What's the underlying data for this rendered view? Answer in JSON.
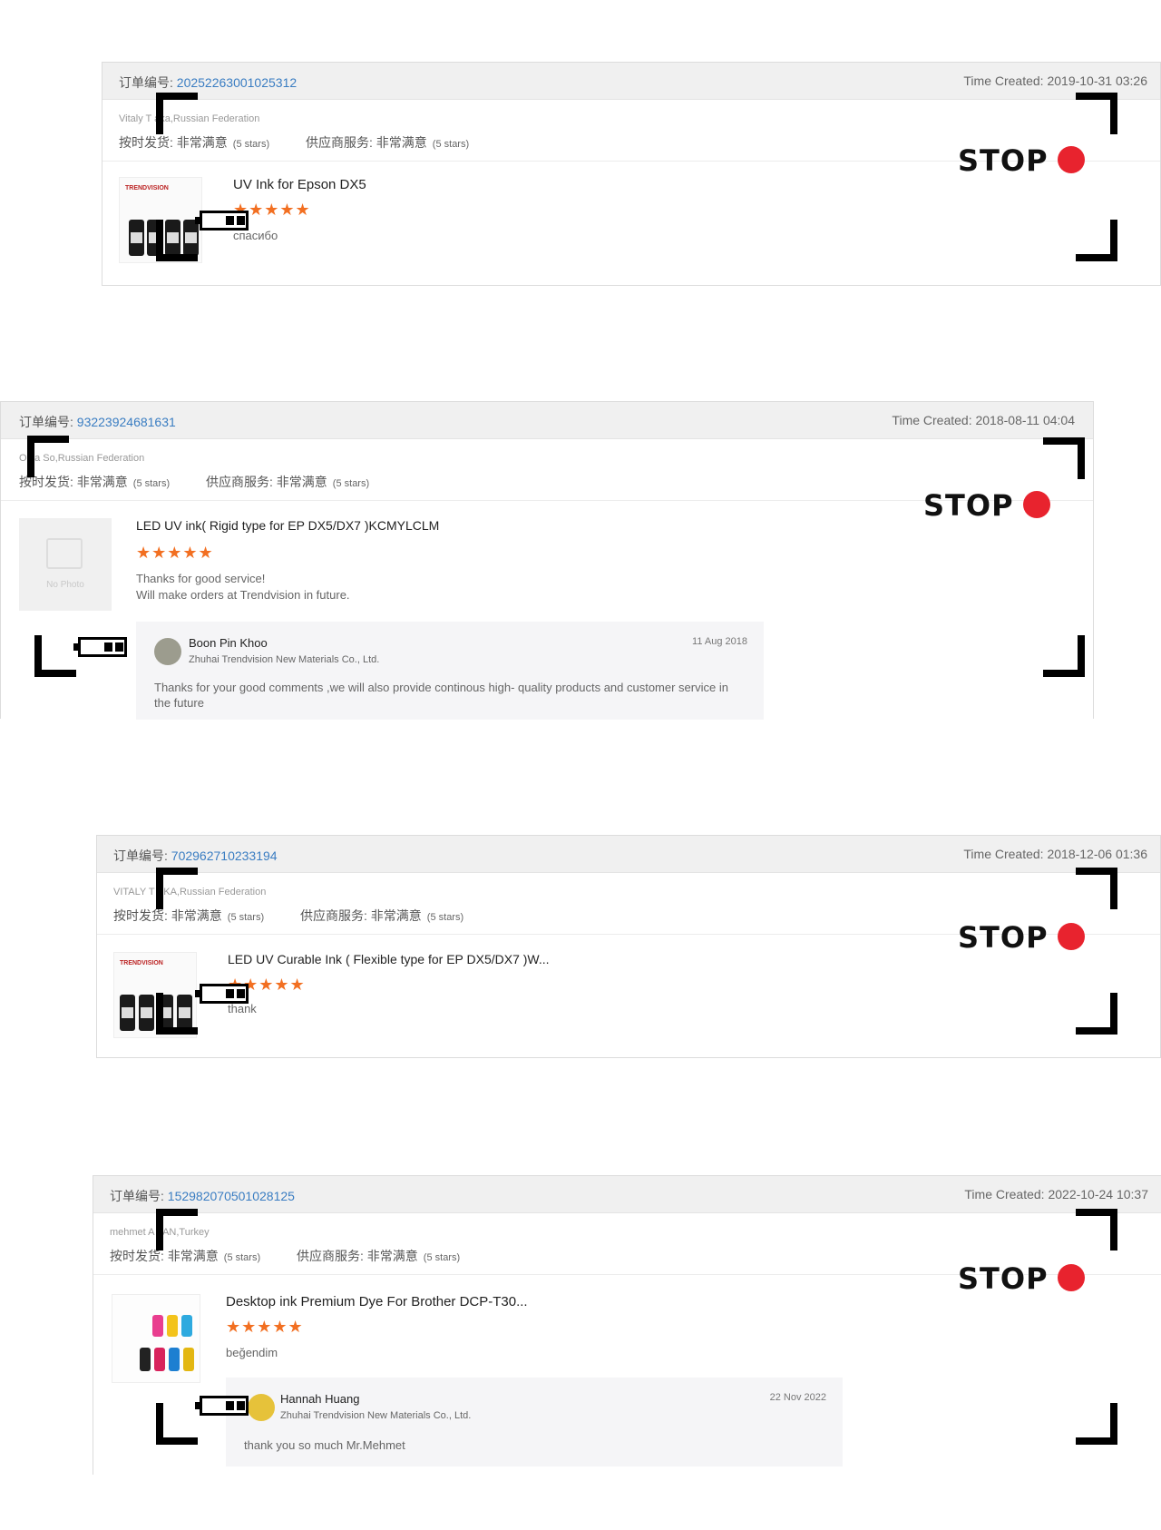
{
  "cards": [
    {
      "order_label": "订单编号",
      "order_number": "20252263001025312",
      "time_created": "Time Created: 2019-10-31 03:26",
      "buyer": "Vitaly T  aka,Russian Federation",
      "rating1_label": "按时发货",
      "rating1_value": "非常满意",
      "rating1_stars": "(5 stars)",
      "rating2_label": "供应商服务",
      "rating2_value": "非常满意",
      "rating2_stars": "(5 stars)",
      "product_title": "UV Ink for Epson DX5",
      "stars": "★★★★★",
      "comment": "спасибо"
    },
    {
      "order_label": "订单编号",
      "order_number": "93223924681631",
      "time_created": "Time Created: 2018-08-11 04:04",
      "buyer": "O  ya So,Russian Federation",
      "rating1_label": "按时发货",
      "rating1_value": "非常满意",
      "rating1_stars": "(5 stars)",
      "rating2_label": "供应商服务",
      "rating2_value": "非常满意",
      "rating2_stars": "(5 stars)",
      "no_photo": "No Photo",
      "product_title": "LED UV ink( Rigid type for EP DX5/DX7 )KCMYLCLM",
      "stars": "★★★★★",
      "comment": "Thanks for good service!\nWill make orders at Trendvision in future.",
      "reply": {
        "name": "Boon Pin Khoo",
        "company": "Zhuhai Trendvision New Materials Co., Ltd.",
        "date": "11 Aug 2018",
        "text": "Thanks for your good comments ,we will also provide continous high- quality products and customer service in the future"
      }
    },
    {
      "order_label": "订单编号",
      "order_number": "702962710233194",
      "time_created": "Time Created: 2018-12-06 01:36",
      "buyer": "VITALY T  AKA,Russian Federation",
      "rating1_label": "按时发货",
      "rating1_value": "非常满意",
      "rating1_stars": "(5 stars)",
      "rating2_label": "供应商服务",
      "rating2_value": "非常满意",
      "rating2_stars": "(5 stars)",
      "product_title": "LED UV Curable Ink ( Flexible type for EP DX5/DX7 )W...",
      "stars": "★★★★★",
      "comment": "thank"
    },
    {
      "order_label": "订单编号",
      "order_number": "152982070501028125",
      "time_created": "Time Created: 2022-10-24 10:37",
      "buyer": "mehmet A  LAN,Turkey",
      "rating1_label": "按时发货",
      "rating1_value": "非常满意",
      "rating1_stars": "(5 stars)",
      "rating2_label": "供应商服务",
      "rating2_value": "非常满意",
      "rating2_stars": "(5 stars)",
      "product_title": "Desktop ink Premium Dye For Brother DCP-T30...",
      "stars": "★★★★★",
      "comment": "beğendim",
      "reply": {
        "name": "Hannah Huang",
        "company": "Zhuhai Trendvision New Materials Co., Ltd.",
        "date": "22 Nov 2022",
        "text": "thank you so much Mr.Mehmet"
      }
    }
  ],
  "overlay": {
    "stop_text": "STOP",
    "brand_text": "TRENDVISION"
  },
  "colors": {
    "order_number": "#3a7dc2",
    "stars": "#f26f21",
    "stop_dot": "#e8232e"
  }
}
